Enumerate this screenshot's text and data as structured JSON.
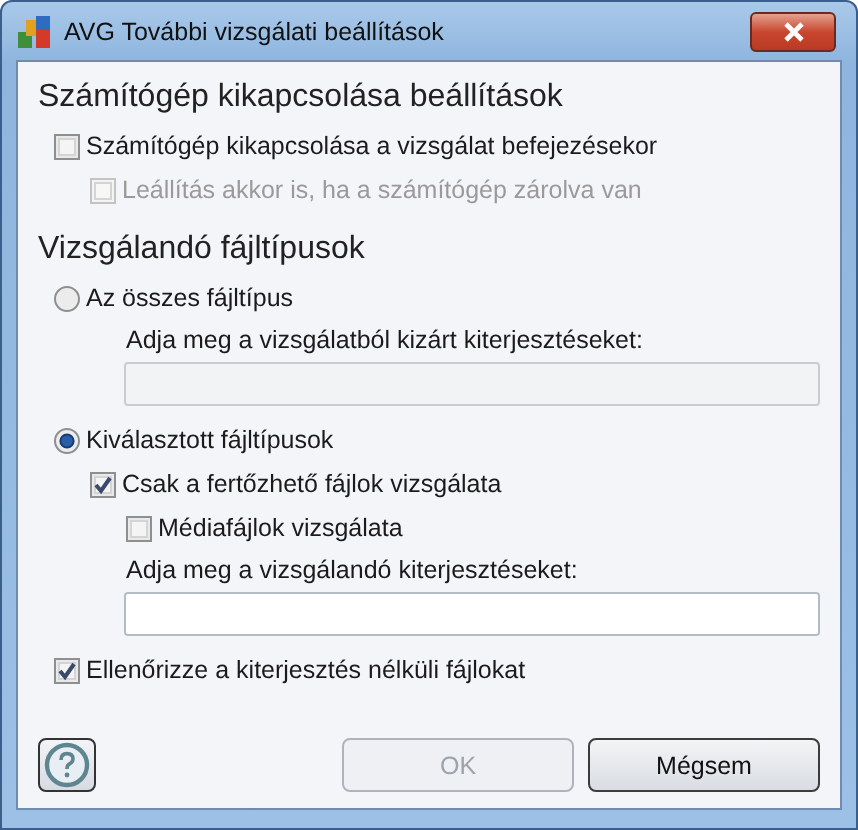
{
  "window": {
    "title": "AVG További vizsgálati beállítások"
  },
  "sections": [
    {
      "heading": "Számítógép kikapcsolása beállítások",
      "items": [
        {
          "kind": "checkbox",
          "label": "Számítógép kikapcsolása a vizsgálat befejezésekor",
          "checked": false,
          "disabled": false,
          "children": [
            {
              "kind": "checkbox",
              "label": "Leállítás akkor is, ha a számítógép zárolva van",
              "checked": false,
              "disabled": true
            }
          ]
        }
      ]
    },
    {
      "heading": "Vizsgálandó fájltípusok",
      "items": [
        {
          "kind": "radio",
          "label": "Az összes fájltípus",
          "selected": false,
          "children": [
            {
              "kind": "field",
              "label": "Adja meg a vizsgálatból kizárt kiterjesztéseket:",
              "disabled": true
            }
          ]
        },
        {
          "kind": "radio",
          "label": "Kiválasztott fájltípusok",
          "selected": true,
          "children": [
            {
              "kind": "checkbox",
              "label": "Csak a fertőzhető fájlok vizsgálata",
              "checked": true,
              "disabled": false,
              "children": [
                {
                  "kind": "checkbox",
                  "label": "Médiafájlok vizsgálata",
                  "checked": false,
                  "disabled": false
                }
              ]
            },
            {
              "kind": "field",
              "label": "Adja meg a vizsgálandó kiterjesztéseket:",
              "disabled": false
            }
          ]
        },
        {
          "kind": "checkbox",
          "label": "Ellenőrizze a kiterjesztés nélküli fájlokat",
          "checked": true,
          "disabled": false
        }
      ]
    }
  ],
  "buttons": [
    {
      "kind": "help"
    },
    {
      "kind": "text",
      "label": "OK",
      "disabled": true
    },
    {
      "kind": "text",
      "label": "Mégsem",
      "disabled": false
    }
  ]
}
